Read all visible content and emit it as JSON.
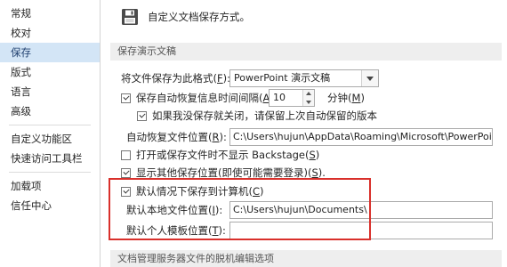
{
  "sidebar": {
    "items": [
      {
        "label": "常规"
      },
      {
        "label": "校对"
      },
      {
        "label": "保存"
      },
      {
        "label": "版式"
      },
      {
        "label": "语言"
      },
      {
        "label": "高级"
      },
      {
        "label": "自定义功能区"
      },
      {
        "label": "快速访问工具栏"
      },
      {
        "label": "加载项"
      },
      {
        "label": "信任中心"
      }
    ],
    "selected_index": 2
  },
  "header": {
    "text": "自定义文档保存方式。"
  },
  "sections": {
    "save_presentations": "保存演示文稿",
    "doc_management": "文档管理服务器文件的脱机编辑选项"
  },
  "format": {
    "label": "将文件保存为此格式(",
    "key": "F",
    "label_end": "):",
    "value": "PowerPoint 演示文稿"
  },
  "autorecover": {
    "label": "保存自动恢复信息时间间隔(",
    "key": "A",
    "label_end": ")",
    "checked": true,
    "interval": "10",
    "unit": "分钟(",
    "unit_key": "M",
    "unit_end": ")"
  },
  "keep_version": {
    "label": "如果我没保存就关闭，请保留上次自动保留的版本",
    "checked": true
  },
  "autorecover_location": {
    "label": "自动恢复文件位置(",
    "key": "R",
    "label_end": "):",
    "value": "C:\\Users\\hujun\\AppData\\Roaming\\Microsoft\\PowerPoint\\"
  },
  "no_backstage": {
    "label": "打开或保存文件时不显示 Backstage(",
    "key": "S",
    "label_end": ")",
    "checked": false
  },
  "show_other_locations": {
    "label": "显示其他保存位置(即使可能需要登录)(",
    "key": "S",
    "label_end": ").",
    "checked": true
  },
  "save_to_computer": {
    "label": "默认情况下保存到计算机(",
    "key": "C",
    "label_end": ")",
    "checked": true
  },
  "local_location": {
    "label": "默认本地文件位置(",
    "key": "I",
    "label_end": "):",
    "value": "C:\\Users\\hujun\\Documents\\"
  },
  "template_location": {
    "label": "默认个人模板位置(",
    "key": "T",
    "label_end": "):",
    "value": ""
  },
  "colors": {
    "highlight": "#d9302b",
    "selected_nav": "#d3e5f6"
  }
}
